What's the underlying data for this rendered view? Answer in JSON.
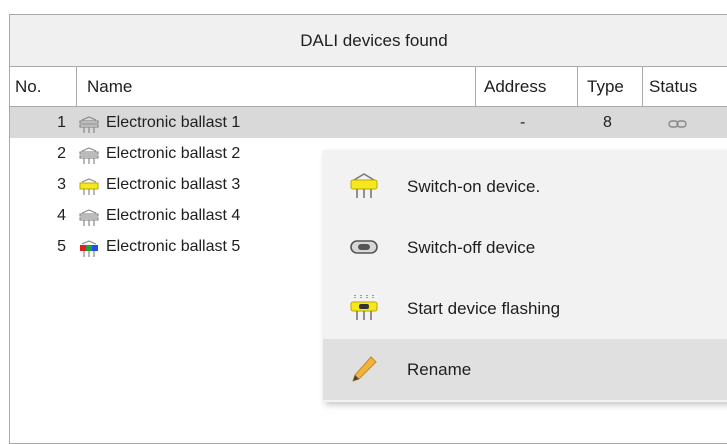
{
  "panel": {
    "title": "DALI devices found"
  },
  "columns": {
    "no": "No.",
    "name": "Name",
    "address": "Address",
    "type": "Type",
    "status": "Status"
  },
  "rows": [
    {
      "no": "1",
      "name": "Electronic ballast 1",
      "address": "-",
      "type": "8",
      "lamp": "outline"
    },
    {
      "no": "2",
      "name": "Electronic ballast 2",
      "lamp": "outline"
    },
    {
      "no": "3",
      "name": "Electronic ballast 3",
      "lamp": "yellow"
    },
    {
      "no": "4",
      "name": "Electronic ballast 4",
      "lamp": "outline"
    },
    {
      "no": "5",
      "name": "Electronic ballast 5",
      "lamp": "rgb"
    }
  ],
  "context_menu": {
    "items": [
      {
        "label": "Switch-on device.",
        "icon": "lamp-on-icon"
      },
      {
        "label": "Switch-off device",
        "icon": "switch-off-icon"
      },
      {
        "label": "Start device flashing",
        "icon": "lamp-flashing-icon"
      },
      {
        "label": "Rename",
        "icon": "pencil-icon"
      }
    ]
  },
  "colors": {
    "selected_row": "#d9d9d9",
    "menu_bg": "#f2f2f2",
    "menu_hover": "#e0e0e0",
    "lamp_yellow": "#f7e81e",
    "border": "#a9a9a9"
  }
}
